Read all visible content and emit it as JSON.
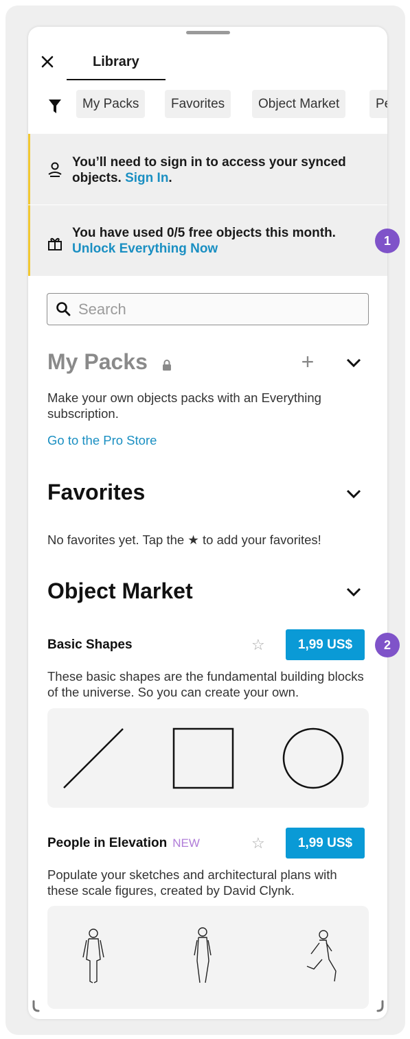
{
  "header": {
    "close_icon": "close-icon",
    "tab_label": "Library"
  },
  "filters": {
    "icon": "filter-icon",
    "chips": [
      "My Packs",
      "Favorites",
      "Object Market",
      "Pe"
    ]
  },
  "banners": [
    {
      "icon": "sign-in-icon",
      "text": "You’ll need to sign in to access your synced objects.",
      "link": "Sign In",
      "suffix": "."
    },
    {
      "icon": "gift-icon",
      "text": "You have used 0/5 free objects this month.",
      "link": "Unlock Everything Now",
      "badge": "1"
    }
  ],
  "search": {
    "placeholder": "Search"
  },
  "my_packs": {
    "title": "My Packs",
    "description": "Make your own objects packs with an Everything subscription.",
    "link": "Go to the Pro Store",
    "add_label": "+"
  },
  "favorites": {
    "title": "Favorites",
    "empty_text": "No favorites yet. Tap the ★ to add your favorites!"
  },
  "object_market": {
    "title": "Object Market",
    "items": [
      {
        "name": "Basic Shapes",
        "tag": "",
        "price": "1,99 US$",
        "badge": "2",
        "description": "These basic shapes are the fundamental building blocks of the universe. So you can create your own."
      },
      {
        "name": "People in Elevation",
        "tag": "NEW",
        "price": "1,99 US$",
        "description": "Populate your sketches and architectural plans with these scale figures, created by David Clynk."
      }
    ]
  },
  "colors": {
    "accent": "#0a9ad6",
    "link": "#1a8fc2",
    "banner_stripe": "#f2c832",
    "badge": "#7f53c9",
    "new_tag": "#b07cd8"
  }
}
